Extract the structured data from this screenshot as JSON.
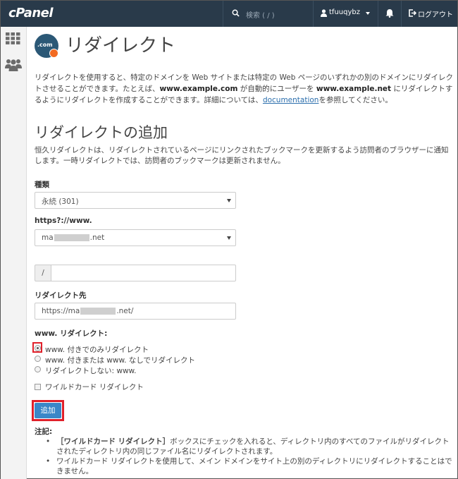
{
  "topbar": {
    "logo": "cPanel",
    "search_placeholder": "検索 ( / )",
    "username": "tfuuqybz",
    "logout_label": "ログアウト"
  },
  "icons": {
    "search": "search-icon",
    "user": "user-icon",
    "bell": "bell-icon",
    "logout": "logout-icon",
    "apps_grid": "grid-icon",
    "users_group": "users-icon"
  },
  "page": {
    "icon_text": ".com",
    "title": "リダイレクト",
    "desc_1": "リダイレクトを使用すると、特定のドメインを Web サイトまたは特定の Web ページのいずれかの別のドメインにリダイレクトさせることができます。たとえば、",
    "desc_b1": "www.example.com",
    "desc_2": " が自動的にユーザーを ",
    "desc_b2": "www.example.net",
    "desc_3": " にリダイレクトするようにリダイレクトを作成することができます。詳細については、",
    "desc_link": "documentation",
    "desc_4": "を参照してください。"
  },
  "form": {
    "section_title": "リダイレクトの追加",
    "section_desc": "恒久リダイレクトは、リダイレクトされているページにリンクされたブックマークを更新するよう訪問者のブラウザーに通知します。一時リダイレクトでは、訪問者のブックマークは更新されません。",
    "type_label": "種類",
    "type_value": "永続 (301)",
    "domain_label": "https?://www.",
    "domain_prefix": "ma",
    "domain_suffix": ".net",
    "path_prefix": "/",
    "path_value": "",
    "target_label": "リダイレクト先",
    "target_prefix": "https://ma",
    "target_suffix": ".net/",
    "www_label": "www. リダイレクト:",
    "radio_options": [
      "www. 付きでのみリダイレクト",
      "www. 付きまたは www. なしでリダイレクト",
      "リダイレクトしない: www."
    ],
    "wildcard_label": "ワイルドカード リダイレクト",
    "add_button": "追加"
  },
  "notes": {
    "title": "注記:",
    "note1_b": "［ワイルドカード リダイレクト］",
    "note1_text": "ボックスにチェックを入れると、ディレクトリ内のすべてのファイルがリダイレクトされたディレクトリ内の同じファイル名にリダイレクトされます。",
    "note2": "ワイルドカード リダイレクトを使用して、メイン ドメインをサイト上の別のディレクトリにリダイレクトすることはできません。"
  },
  "colors": {
    "topbar": "#293a4a",
    "button": "#3a87c8",
    "highlight": "#e0202a",
    "link": "#2c6fad",
    "badge": "#f26a21"
  }
}
